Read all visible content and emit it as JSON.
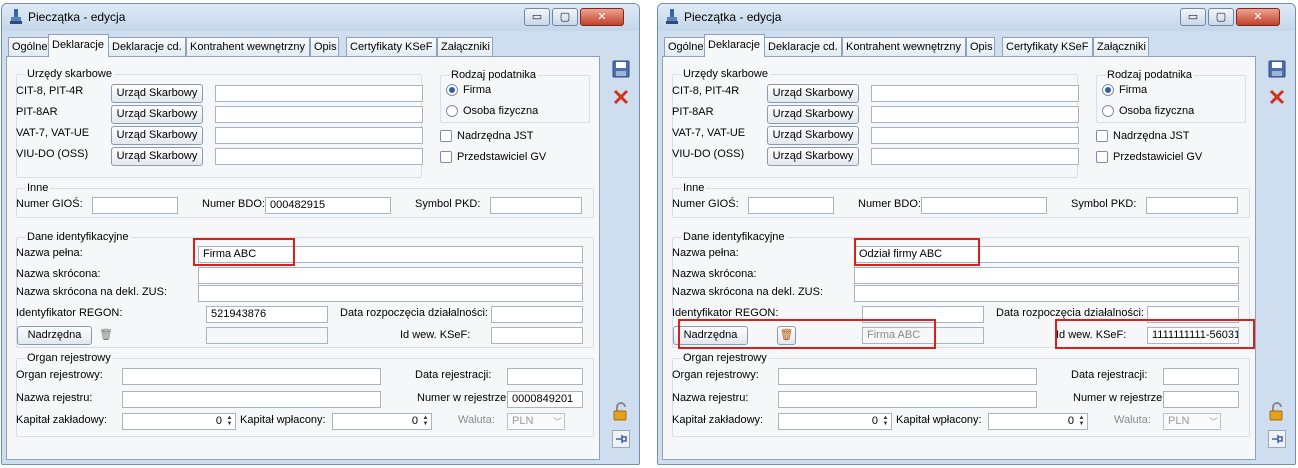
{
  "windows": [
    {
      "title": "Pieczątka - edycja",
      "controls": {
        "minimize": "▭",
        "maximize": "▢",
        "close": "✕"
      },
      "tabs": [
        "Ogólne",
        "Deklaracje",
        "Deklaracje cd.",
        "Kontrahent wewnętrzny",
        "Opis",
        "Certyfikaty KSeF",
        "Załączniki"
      ],
      "tax": {
        "legend": "Urzędy skarbowe",
        "rows": [
          {
            "label": "CIT-8, PIT-4R",
            "button": "Urząd Skarbowy",
            "value": ""
          },
          {
            "label": "PIT-8AR",
            "button": "Urząd Skarbowy",
            "value": ""
          },
          {
            "label": "VAT-7, VAT-UE",
            "button": "Urząd Skarbowy",
            "value": ""
          },
          {
            "label": "VIU-DO (OSS)",
            "button": "Urząd Skarbowy",
            "value": ""
          }
        ]
      },
      "taxpayer": {
        "legend": "Rodzaj podatnika",
        "firma": "Firma",
        "osoba": "Osoba fizyczna",
        "selected": "firma",
        "nadrzedna_jst": "Nadrzędna JST",
        "przedstawiciel": "Przedstawiciel GV"
      },
      "inne": {
        "legend": "Inne",
        "gios_label": "Numer GIOŚ:",
        "gios": "",
        "bdo_label": "Numer BDO:",
        "bdo": "000482915",
        "pkd_label": "Symbol PKD:",
        "pkd": ""
      },
      "dane": {
        "legend": "Dane identyfikacyjne",
        "nazwa_pelna_label": "Nazwa pełna:",
        "nazwa_pelna": "Firma ABC",
        "nazwa_skrocona_label": "Nazwa skrócona:",
        "nazwa_skrocona": "",
        "nazwa_zus_label": "Nazwa skrócona na dekl. ZUS:",
        "nazwa_zus": "",
        "regon_label": "Identyfikator REGON:",
        "regon": "521943876",
        "data_rozp_label": "Data rozpoczęcia działalności:",
        "data_rozp": "",
        "nadrzedna_btn": "Nadrzędna",
        "nadrzedna_value": "",
        "ksef_label": "Id wew. KSeF:",
        "ksef": ""
      },
      "organ": {
        "legend": "Organ rejestrowy",
        "organ_label": "Organ rejestrowy:",
        "organ": "",
        "data_rej_label": "Data rejestracji:",
        "data_rej": "",
        "nazwa_rej_label": "Nazwa rejestru:",
        "nazwa_rej": "",
        "numer_label": "Numer w rejestrze",
        "numer": "0000849201",
        "kapital_z_label": "Kapitał zakładowy:",
        "kapital_z": "0",
        "kapital_w_label": "Kapitał wpłacony:",
        "kapital_w": "0",
        "waluta_label": "Waluta:",
        "waluta": "PLN"
      }
    },
    {
      "title": "Pieczątka - edycja",
      "controls": {
        "minimize": "▭",
        "maximize": "▢",
        "close": "✕"
      },
      "tabs": [
        "Ogólne",
        "Deklaracje",
        "Deklaracje cd.",
        "Kontrahent wewnętrzny",
        "Opis",
        "Certyfikaty KSeF",
        "Załączniki"
      ],
      "tax": {
        "legend": "Urzędy skarbowe",
        "rows": [
          {
            "label": "CIT-8, PIT-4R",
            "button": "Urząd Skarbowy",
            "value": ""
          },
          {
            "label": "PIT-8AR",
            "button": "Urząd Skarbowy",
            "value": ""
          },
          {
            "label": "VAT-7, VAT-UE",
            "button": "Urząd Skarbowy",
            "value": ""
          },
          {
            "label": "VIU-DO (OSS)",
            "button": "Urząd Skarbowy",
            "value": ""
          }
        ]
      },
      "taxpayer": {
        "legend": "Rodzaj podatnika",
        "firma": "Firma",
        "osoba": "Osoba fizyczna",
        "selected": "firma",
        "nadrzedna_jst": "Nadrzędna JST",
        "przedstawiciel": "Przedstawiciel GV"
      },
      "inne": {
        "legend": "Inne",
        "gios_label": "Numer GIOŚ:",
        "gios": "",
        "bdo_label": "Numer BDO:",
        "bdo": "",
        "pkd_label": "Symbol PKD:",
        "pkd": ""
      },
      "dane": {
        "legend": "Dane identyfikacyjne",
        "nazwa_pelna_label": "Nazwa pełna:",
        "nazwa_pelna": "Odział firmy ABC",
        "nazwa_skrocona_label": "Nazwa skrócona:",
        "nazwa_skrocona": "",
        "nazwa_zus_label": "Nazwa skrócona na dekl. ZUS:",
        "nazwa_zus": "",
        "regon_label": "Identyfikator REGON:",
        "regon": "",
        "data_rozp_label": "Data rozpoczęcia działalności:",
        "data_rozp": "",
        "nadrzedna_btn": "Nadrzędna",
        "nadrzedna_value": "Firma ABC",
        "ksef_label": "Id wew. KSeF:",
        "ksef": "1111111111-56031"
      },
      "organ": {
        "legend": "Organ rejestrowy",
        "organ_label": "Organ rejestrowy:",
        "organ": "",
        "data_rej_label": "Data rejestracji:",
        "data_rej": "",
        "nazwa_rej_label": "Nazwa rejestru:",
        "nazwa_rej": "",
        "numer_label": "Numer w rejestrze",
        "numer": "",
        "kapital_z_label": "Kapitał zakładowy:",
        "kapital_z": "0",
        "kapital_w_label": "Kapitał wpłacony:",
        "kapital_w": "0",
        "waluta_label": "Waluta:",
        "waluta": "PLN"
      }
    }
  ],
  "icons": {
    "save": "save-icon",
    "cancel": "cancel-icon",
    "lock": "padlock-icon",
    "pin": "pin-icon",
    "trash": "trash-icon",
    "stamp": "stamp-icon"
  },
  "colors": {
    "highlight": "#d9201a",
    "accent": "#2d5fa8"
  }
}
